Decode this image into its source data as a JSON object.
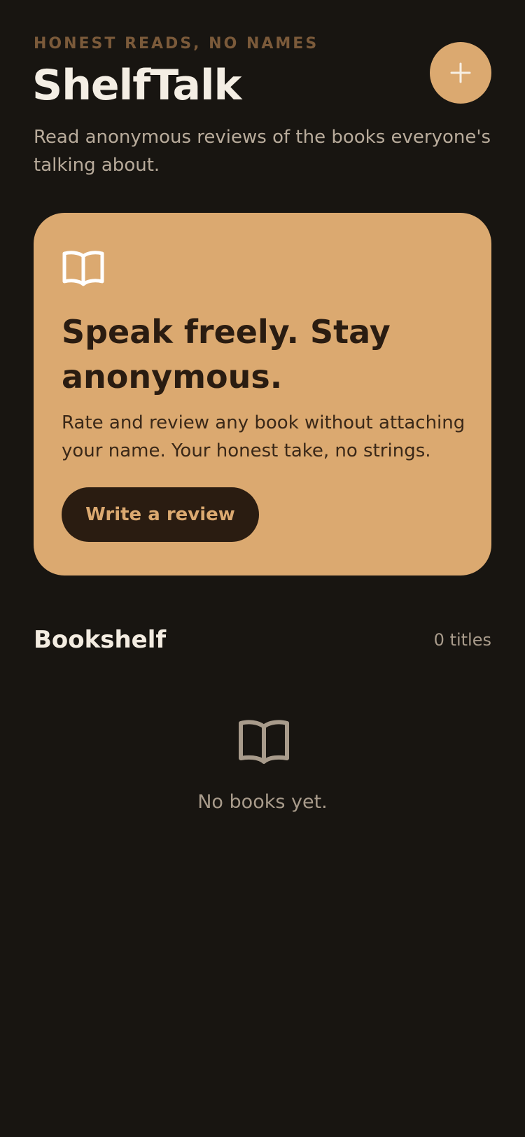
{
  "header": {
    "eyebrow": "HONEST READS, NO NAMES",
    "title": "ShelfTalk",
    "subtitle": "Read anonymous reviews of the books everyone's talking about.",
    "add_button_icon": "plus-icon"
  },
  "hero": {
    "icon": "open-book-icon",
    "title": "Speak freely. Stay anonymous.",
    "body": "Rate and review any book without attaching your name. Your honest take, no strings.",
    "cta_label": "Write a review"
  },
  "bookshelf": {
    "title": "Bookshelf",
    "count_label": "0 titles",
    "empty_icon": "open-book-icon",
    "empty_text": "No books yet."
  },
  "colors": {
    "background": "#181511",
    "accent": "#dba970",
    "accent_dark": "#2a1c11",
    "muted_text": "#a89b8b",
    "eyebrow": "#7b5a3a"
  }
}
